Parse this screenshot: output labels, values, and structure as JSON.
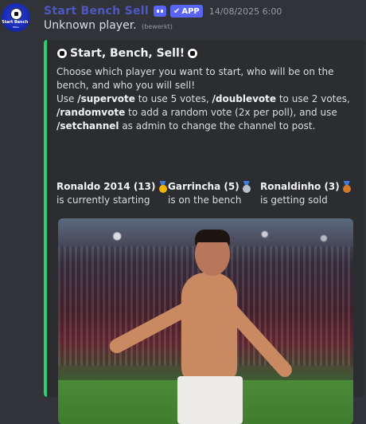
{
  "message": {
    "author": "Start Bench Sell",
    "badge": "APP",
    "timestamp": "14/08/2025 6:00",
    "content": "Unknown player.",
    "edited": "(bewerkt)",
    "avatar_text": "Start Bench Sell",
    "avatar_subtext": "Elite"
  },
  "embed": {
    "accent_color": "#2ecc71",
    "title": "Start, Bench, Sell!",
    "description": {
      "line1": "Choose which player you want to start, who will be on the bench, and who you will sell!",
      "use1": "Use ",
      "cmd_supervote": "/supervote",
      "supervote_text": " to use 5 votes, ",
      "cmd_doublevote": "/doublevote",
      "doublevote_text": " to use 2 votes, ",
      "cmd_randomvote": "/randomvote",
      "randomvote_text": " to add a random vote (2x per poll), and use ",
      "cmd_setchannel": "/setchannel",
      "setchannel_text": " as admin to change the channel to post."
    },
    "fields": [
      {
        "name": "Ronaldo 2014 (13)",
        "medal": "gold-medal-icon",
        "value": "is currently starting"
      },
      {
        "name": "Garrincha (5)",
        "medal": "silver-medal-icon",
        "value": "is on the bench"
      },
      {
        "name": "Ronaldinho (3)",
        "medal": "bronze-medal-icon",
        "value": "is getting sold"
      }
    ]
  }
}
